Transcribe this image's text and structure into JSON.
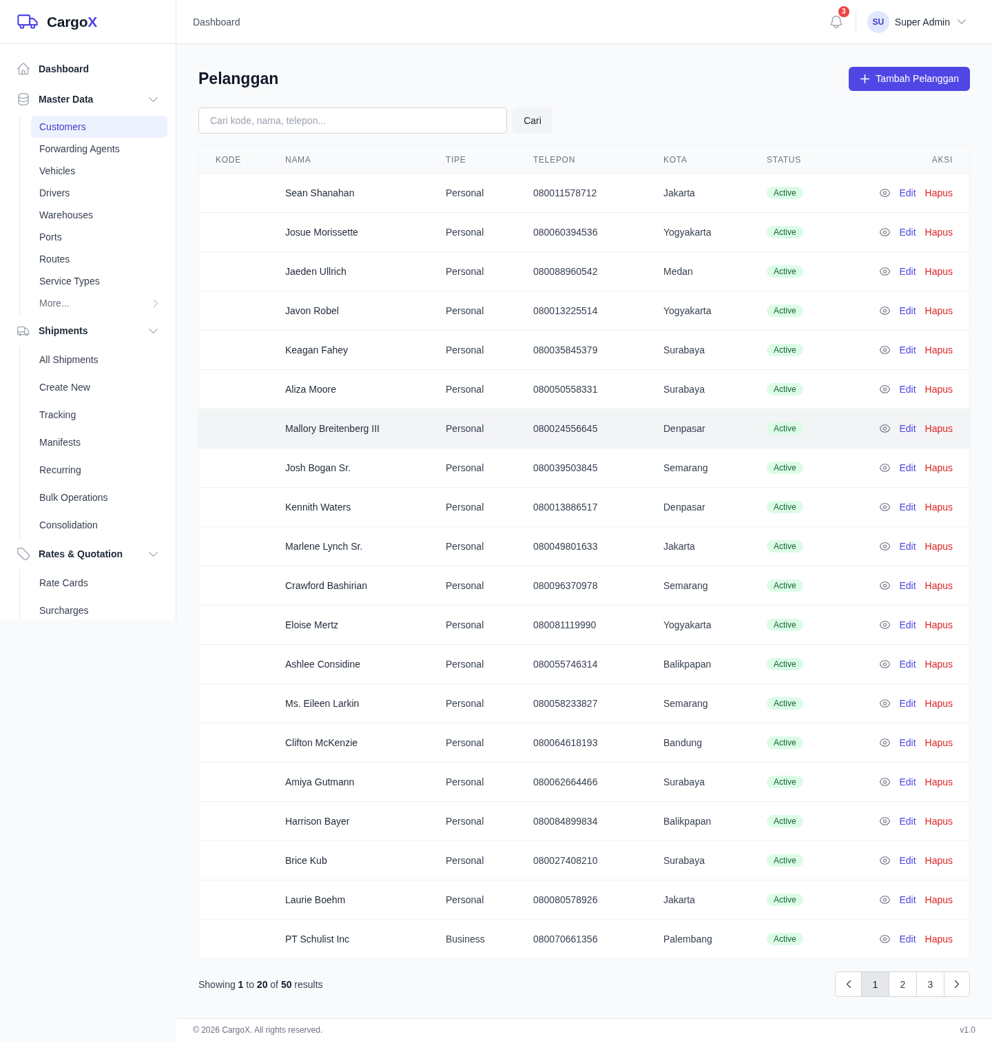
{
  "sidebar": {
    "logo": {
      "text": "Cargo",
      "accent": "X"
    },
    "nav": [
      {
        "label": "Dashboard",
        "selected": false
      },
      {
        "label": "Master Data",
        "selected": false,
        "expanded": true,
        "children": [
          {
            "label": "Customers",
            "selected": true,
            "kind": "link"
          },
          {
            "label": "Forwarding Agents",
            "selected": false,
            "kind": "link"
          },
          {
            "label": "Vehicles",
            "selected": false,
            "kind": "link"
          },
          {
            "label": "Drivers",
            "selected": false,
            "kind": "link"
          },
          {
            "label": "Warehouses",
            "selected": false,
            "kind": "link"
          },
          {
            "label": "Ports",
            "selected": false,
            "kind": "link"
          },
          {
            "label": "Routes",
            "selected": false,
            "kind": "link"
          },
          {
            "label": "Service Types",
            "selected": false,
            "kind": "link"
          },
          {
            "label": "More...",
            "selected": false,
            "kind": "more"
          }
        ]
      },
      {
        "label": "Shipments",
        "selected": false,
        "expanded": true,
        "children": [
          {
            "label": "All Shipments",
            "selected": false
          },
          {
            "label": "Create New",
            "selected": false
          },
          {
            "label": "Tracking",
            "selected": false
          },
          {
            "label": "Manifests",
            "selected": false
          },
          {
            "label": "Recurring",
            "selected": false
          },
          {
            "label": "Bulk Operations",
            "selected": false
          },
          {
            "label": "Consolidation",
            "selected": false
          }
        ]
      },
      {
        "label": "Rates & Quotation",
        "selected": false,
        "expanded": true,
        "children": [
          {
            "label": "Rate Cards",
            "selected": false
          },
          {
            "label": "Surcharges",
            "selected": false
          }
        ]
      }
    ]
  },
  "header": {
    "breadcrumb": "Dashboard",
    "notifications": {
      "count": "3"
    },
    "user": {
      "initials": "SU",
      "name": "Super Admin"
    }
  },
  "page": {
    "title": "Pelanggan",
    "add_button": "Tambah Pelanggan"
  },
  "search": {
    "placeholder": "Cari kode, nama, telepon...",
    "button": "Cari"
  },
  "table": {
    "columns": [
      "KODE",
      "NAMA",
      "TIPE",
      "TELEPON",
      "KOTA",
      "STATUS",
      "AKSI"
    ],
    "rows": [
      {
        "nama": "Sean Shanahan",
        "tipe": "Personal",
        "telepon": "080011578712",
        "kota": "Jakarta",
        "status": "Active",
        "edit": "Edit",
        "delete": "Hapus",
        "selected": false
      },
      {
        "nama": "Josue Morissette",
        "tipe": "Personal",
        "telepon": "080060394536",
        "kota": "Yogyakarta",
        "status": "Active",
        "edit": "Edit",
        "delete": "Hapus",
        "selected": false
      },
      {
        "nama": "Jaeden Ullrich",
        "tipe": "Personal",
        "telepon": "080088960542",
        "kota": "Medan",
        "status": "Active",
        "edit": "Edit",
        "delete": "Hapus",
        "selected": false
      },
      {
        "nama": "Javon Robel",
        "tipe": "Personal",
        "telepon": "080013225514",
        "kota": "Yogyakarta",
        "status": "Active",
        "edit": "Edit",
        "delete": "Hapus",
        "selected": false
      },
      {
        "nama": "Keagan Fahey",
        "tipe": "Personal",
        "telepon": "080035845379",
        "kota": "Surabaya",
        "status": "Active",
        "edit": "Edit",
        "delete": "Hapus",
        "selected": false
      },
      {
        "nama": "Aliza Moore",
        "tipe": "Personal",
        "telepon": "080050558331",
        "kota": "Surabaya",
        "status": "Active",
        "edit": "Edit",
        "delete": "Hapus",
        "selected": false
      },
      {
        "nama": "Mallory Breitenberg III",
        "tipe": "Personal",
        "telepon": "080024556645",
        "kota": "Denpasar",
        "status": "Active",
        "edit": "Edit",
        "delete": "Hapus",
        "selected": true
      },
      {
        "nama": "Josh Bogan Sr.",
        "tipe": "Personal",
        "telepon": "080039503845",
        "kota": "Semarang",
        "status": "Active",
        "edit": "Edit",
        "delete": "Hapus",
        "selected": false
      },
      {
        "nama": "Kennith Waters",
        "tipe": "Personal",
        "telepon": "080013886517",
        "kota": "Denpasar",
        "status": "Active",
        "edit": "Edit",
        "delete": "Hapus",
        "selected": false
      },
      {
        "nama": "Marlene Lynch Sr.",
        "tipe": "Personal",
        "telepon": "080049801633",
        "kota": "Jakarta",
        "status": "Active",
        "edit": "Edit",
        "delete": "Hapus",
        "selected": false
      },
      {
        "nama": "Crawford Bashirian",
        "tipe": "Personal",
        "telepon": "080096370978",
        "kota": "Semarang",
        "status": "Active",
        "edit": "Edit",
        "delete": "Hapus",
        "selected": false
      },
      {
        "nama": "Eloise Mertz",
        "tipe": "Personal",
        "telepon": "080081119990",
        "kota": "Yogyakarta",
        "status": "Active",
        "edit": "Edit",
        "delete": "Hapus",
        "selected": false
      },
      {
        "nama": "Ashlee Considine",
        "tipe": "Personal",
        "telepon": "080055746314",
        "kota": "Balikpapan",
        "status": "Active",
        "edit": "Edit",
        "delete": "Hapus",
        "selected": false
      },
      {
        "nama": "Ms. Eileen Larkin",
        "tipe": "Personal",
        "telepon": "080058233827",
        "kota": "Semarang",
        "status": "Active",
        "edit": "Edit",
        "delete": "Hapus",
        "selected": false
      },
      {
        "nama": "Clifton McKenzie",
        "tipe": "Personal",
        "telepon": "080064618193",
        "kota": "Bandung",
        "status": "Active",
        "edit": "Edit",
        "delete": "Hapus",
        "selected": false
      },
      {
        "nama": "Amiya Gutmann",
        "tipe": "Personal",
        "telepon": "080062664466",
        "kota": "Surabaya",
        "status": "Active",
        "edit": "Edit",
        "delete": "Hapus",
        "selected": false
      },
      {
        "nama": "Harrison Bayer",
        "tipe": "Personal",
        "telepon": "080084899834",
        "kota": "Balikpapan",
        "status": "Active",
        "edit": "Edit",
        "delete": "Hapus",
        "selected": false
      },
      {
        "nama": "Brice Kub",
        "tipe": "Personal",
        "telepon": "080027408210",
        "kota": "Surabaya",
        "status": "Active",
        "edit": "Edit",
        "delete": "Hapus",
        "selected": false
      },
      {
        "nama": "Laurie Boehm",
        "tipe": "Personal",
        "telepon": "080080578926",
        "kota": "Jakarta",
        "status": "Active",
        "edit": "Edit",
        "delete": "Hapus",
        "selected": false
      },
      {
        "nama": "PT Schulist Inc",
        "tipe": "Business",
        "telepon": "080070661356",
        "kota": "Palembang",
        "status": "Active",
        "edit": "Edit",
        "delete": "Hapus",
        "selected": false
      }
    ]
  },
  "pagination": {
    "summary": "Showing **1** to **20** of **50** results",
    "pages": [
      {
        "label": "1",
        "selected": true
      },
      {
        "label": "2",
        "selected": false
      },
      {
        "label": "3",
        "selected": false
      }
    ]
  },
  "footer": {
    "copyright": "© 2026 CargoX. All rights reserved.",
    "version": "v1.0"
  }
}
